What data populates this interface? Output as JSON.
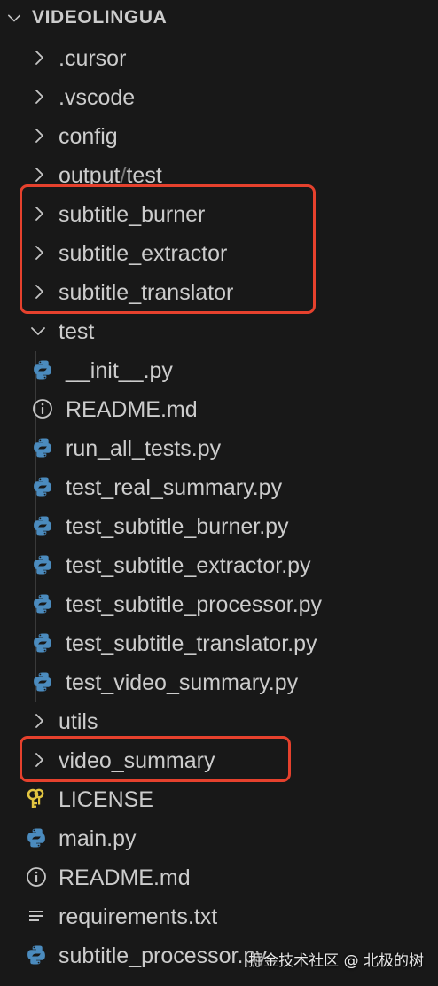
{
  "explorer": {
    "section_title": "VIDEOLINGUA",
    "items": [
      {
        "kind": "folder",
        "label": ".cursor",
        "expanded": false
      },
      {
        "kind": "folder",
        "label": ".vscode",
        "expanded": false
      },
      {
        "kind": "folder",
        "label": "config",
        "expanded": false
      },
      {
        "kind": "folder",
        "label_a": "output",
        "label_sep": "/",
        "label_b": "test",
        "expanded": false
      },
      {
        "kind": "folder",
        "label": "subtitle_burner",
        "expanded": false
      },
      {
        "kind": "folder",
        "label": "subtitle_extractor",
        "expanded": false
      },
      {
        "kind": "folder",
        "label": "subtitle_translator",
        "expanded": false
      },
      {
        "kind": "folder",
        "label": "test",
        "expanded": true
      },
      {
        "kind": "file",
        "icon": "python-icon",
        "label": "__init__.py"
      },
      {
        "kind": "file",
        "icon": "info-icon",
        "label": "README.md"
      },
      {
        "kind": "file",
        "icon": "python-icon",
        "label": "run_all_tests.py"
      },
      {
        "kind": "file",
        "icon": "python-icon",
        "label": "test_real_summary.py"
      },
      {
        "kind": "file",
        "icon": "python-icon",
        "label": "test_subtitle_burner.py"
      },
      {
        "kind": "file",
        "icon": "python-icon",
        "label": "test_subtitle_extractor.py"
      },
      {
        "kind": "file",
        "icon": "python-icon",
        "label": "test_subtitle_processor.py"
      },
      {
        "kind": "file",
        "icon": "python-icon",
        "label": "test_subtitle_translator.py"
      },
      {
        "kind": "file",
        "icon": "python-icon",
        "label": "test_video_summary.py"
      },
      {
        "kind": "folder",
        "label": "utils",
        "expanded": false
      },
      {
        "kind": "folder",
        "label": "video_summary",
        "expanded": false
      },
      {
        "kind": "file",
        "icon": "key-icon",
        "label": "LICENSE"
      },
      {
        "kind": "file",
        "icon": "python-icon",
        "label": "main.py"
      },
      {
        "kind": "file",
        "icon": "info-icon",
        "label": "README.md"
      },
      {
        "kind": "file",
        "icon": "lines-icon",
        "label": "requirements.txt"
      },
      {
        "kind": "file",
        "icon": "python-icon",
        "label": "subtitle_processor.py"
      }
    ]
  },
  "colors": {
    "background": "#181818",
    "text": "#cccccc",
    "highlight_border": "#e5412d",
    "python_blue": "#4b8bbe",
    "python_yellow": "#ffd43b",
    "key_yellow": "#e2c541"
  },
  "watermark": "掘金技术社区 @ 北极的树"
}
